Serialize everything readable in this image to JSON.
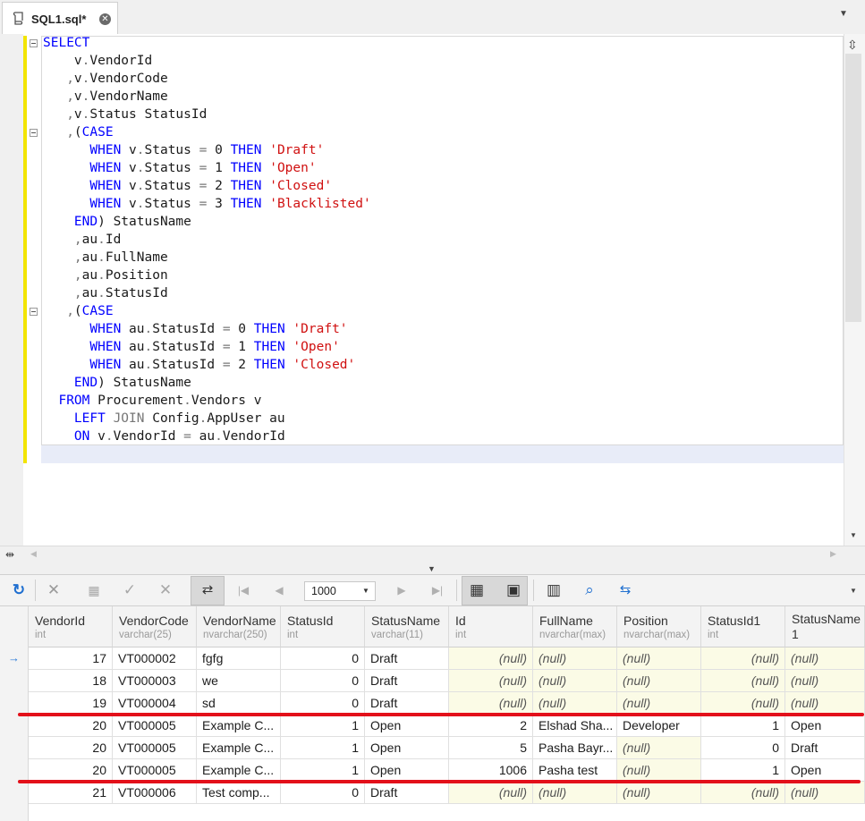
{
  "tab": {
    "title": "SQL1.sql*",
    "icon": "sql-script-icon",
    "close_icon": "close-icon",
    "menu_icon": "chevron-down-icon"
  },
  "editor": {
    "lines": [
      [
        [
          "kw",
          "SELECT"
        ]
      ],
      [
        [
          "t",
          "    v"
        ],
        [
          "op",
          "."
        ],
        [
          "t",
          "VendorId"
        ]
      ],
      [
        [
          "op",
          "   ,"
        ],
        [
          "t",
          "v"
        ],
        [
          "op",
          "."
        ],
        [
          "t",
          "VendorCode"
        ]
      ],
      [
        [
          "op",
          "   ,"
        ],
        [
          "t",
          "v"
        ],
        [
          "op",
          "."
        ],
        [
          "t",
          "VendorName"
        ]
      ],
      [
        [
          "op",
          "   ,"
        ],
        [
          "t",
          "v"
        ],
        [
          "op",
          "."
        ],
        [
          "t",
          "Status StatusId"
        ]
      ],
      [
        [
          "op",
          "   ,"
        ],
        [
          "t",
          "("
        ],
        [
          "kw",
          "CASE"
        ]
      ],
      [
        [
          "kw",
          "      WHEN"
        ],
        [
          "t",
          " v"
        ],
        [
          "op",
          "."
        ],
        [
          "t",
          "Status "
        ],
        [
          "op",
          "="
        ],
        [
          "t",
          " 0 "
        ],
        [
          "kw",
          "THEN"
        ],
        [
          "str",
          " 'Draft'"
        ]
      ],
      [
        [
          "kw",
          "      WHEN"
        ],
        [
          "t",
          " v"
        ],
        [
          "op",
          "."
        ],
        [
          "t",
          "Status "
        ],
        [
          "op",
          "="
        ],
        [
          "t",
          " 1 "
        ],
        [
          "kw",
          "THEN"
        ],
        [
          "str",
          " 'Open'"
        ]
      ],
      [
        [
          "kw",
          "      WHEN"
        ],
        [
          "t",
          " v"
        ],
        [
          "op",
          "."
        ],
        [
          "t",
          "Status "
        ],
        [
          "op",
          "="
        ],
        [
          "t",
          " 2 "
        ],
        [
          "kw",
          "THEN"
        ],
        [
          "str",
          " 'Closed'"
        ]
      ],
      [
        [
          "kw",
          "      WHEN"
        ],
        [
          "t",
          " v"
        ],
        [
          "op",
          "."
        ],
        [
          "t",
          "Status "
        ],
        [
          "op",
          "="
        ],
        [
          "t",
          " 3 "
        ],
        [
          "kw",
          "THEN"
        ],
        [
          "str",
          " 'Blacklisted'"
        ]
      ],
      [
        [
          "kw",
          "    END"
        ],
        [
          "t",
          ") StatusName"
        ]
      ],
      [
        [
          "op",
          "    ,"
        ],
        [
          "t",
          "au"
        ],
        [
          "op",
          "."
        ],
        [
          "t",
          "Id"
        ]
      ],
      [
        [
          "op",
          "    ,"
        ],
        [
          "t",
          "au"
        ],
        [
          "op",
          "."
        ],
        [
          "t",
          "FullName"
        ]
      ],
      [
        [
          "op",
          "    ,"
        ],
        [
          "t",
          "au"
        ],
        [
          "op",
          "."
        ],
        [
          "t",
          "Position"
        ]
      ],
      [
        [
          "op",
          "    ,"
        ],
        [
          "t",
          "au"
        ],
        [
          "op",
          "."
        ],
        [
          "t",
          "StatusId"
        ]
      ],
      [
        [
          "op",
          "   ,"
        ],
        [
          "t",
          "("
        ],
        [
          "kw",
          "CASE"
        ]
      ],
      [
        [
          "kw",
          "      WHEN"
        ],
        [
          "t",
          " au"
        ],
        [
          "op",
          "."
        ],
        [
          "t",
          "StatusId "
        ],
        [
          "op",
          "="
        ],
        [
          "t",
          " 0 "
        ],
        [
          "kw",
          "THEN"
        ],
        [
          "str",
          " 'Draft'"
        ]
      ],
      [
        [
          "kw",
          "      WHEN"
        ],
        [
          "t",
          " au"
        ],
        [
          "op",
          "."
        ],
        [
          "t",
          "StatusId "
        ],
        [
          "op",
          "="
        ],
        [
          "t",
          " 1 "
        ],
        [
          "kw",
          "THEN"
        ],
        [
          "str",
          " 'Open'"
        ]
      ],
      [
        [
          "kw",
          "      WHEN"
        ],
        [
          "t",
          " au"
        ],
        [
          "op",
          "."
        ],
        [
          "t",
          "StatusId "
        ],
        [
          "op",
          "="
        ],
        [
          "t",
          " 2 "
        ],
        [
          "kw",
          "THEN"
        ],
        [
          "str",
          " 'Closed'"
        ]
      ],
      [
        [
          "kw",
          "    END"
        ],
        [
          "t",
          ") StatusName"
        ]
      ],
      [
        [
          "kw",
          "  FROM"
        ],
        [
          "t",
          " Procurement"
        ],
        [
          "op",
          "."
        ],
        [
          "t",
          "Vendors v"
        ]
      ],
      [
        [
          "kw",
          "    LEFT"
        ],
        [
          "op",
          " JOIN"
        ],
        [
          "t",
          " Config"
        ],
        [
          "op",
          "."
        ],
        [
          "t",
          "AppUser au"
        ]
      ],
      [
        [
          "kw",
          "    ON"
        ],
        [
          "t",
          " v"
        ],
        [
          "op",
          "."
        ],
        [
          "t",
          "VendorId "
        ],
        [
          "op",
          "="
        ],
        [
          "t",
          " au"
        ],
        [
          "op",
          "."
        ],
        [
          "t",
          "VendorId"
        ]
      ]
    ]
  },
  "toolbar": {
    "icons": [
      "refresh-icon",
      "delete-icon",
      "insert-icon",
      "apply-icon",
      "cancel-icon",
      "toggle-icon",
      "first-page-icon",
      "previous-page-icon",
      "next-page-icon",
      "last-page-icon",
      "grid-view-icon",
      "card-view-icon",
      "columns-icon",
      "find-icon",
      "export-icon"
    ],
    "row_limit": "1000"
  },
  "grid": {
    "columns": [
      {
        "name": "VendorId",
        "type": "int"
      },
      {
        "name": "VendorCode",
        "type": "varchar(25)"
      },
      {
        "name": "VendorName",
        "type": "nvarchar(250)"
      },
      {
        "name": "StatusId",
        "type": "int"
      },
      {
        "name": "StatusName",
        "type": "varchar(11)"
      },
      {
        "name": "Id",
        "type": "int"
      },
      {
        "name": "FullName",
        "type": "nvarchar(max)"
      },
      {
        "name": "Position",
        "type": "nvarchar(max)"
      },
      {
        "name": "StatusId1",
        "type": "int"
      },
      {
        "name": "StatusName\n1",
        "type": ""
      }
    ],
    "null_text": "(null)",
    "rows": [
      [
        "17",
        "VT000002",
        "fgfg",
        "0",
        "Draft",
        null,
        null,
        null,
        null,
        null
      ],
      [
        "18",
        "VT000003",
        "we",
        "0",
        "Draft",
        null,
        null,
        null,
        null,
        null
      ],
      [
        "19",
        "VT000004",
        "sd",
        "0",
        "Draft",
        null,
        null,
        null,
        null,
        null
      ],
      [
        "20",
        "VT000005",
        "Example C...",
        "1",
        "Open",
        "2",
        "Elshad Sha...",
        "Developer",
        "1",
        "Open"
      ],
      [
        "20",
        "VT000005",
        "Example C...",
        "1",
        "Open",
        "5",
        "Pasha Bayr...",
        null,
        "0",
        "Draft"
      ],
      [
        "20",
        "VT000005",
        "Example C...",
        "1",
        "Open",
        "1006",
        "Pasha test",
        null,
        "1",
        "Open"
      ],
      [
        "21",
        "VT000006",
        "Test comp...",
        "0",
        "Draft",
        null,
        null,
        null,
        null,
        null
      ]
    ],
    "current_row_marker": "→",
    "highlight_color": "#e3101a"
  }
}
